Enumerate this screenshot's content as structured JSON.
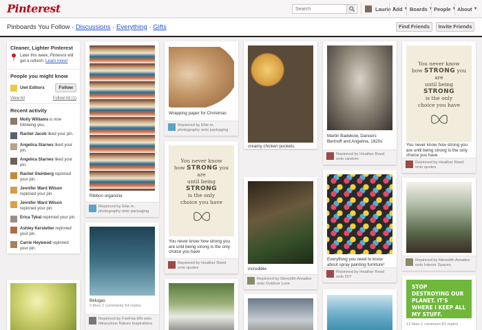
{
  "header": {
    "logo": "Pinterest",
    "search_placeholder": "Search",
    "nav": {
      "user": "Laurie",
      "add": "Add",
      "boards": "Boards",
      "people": "People",
      "about": "About"
    }
  },
  "subheader": {
    "title": "Pinboards You Follow · ",
    "links": [
      "Discussions",
      "Everything",
      "Gifts"
    ],
    "sep": " · ",
    "find_friends": "Find Friends",
    "invite_friends": "Invite Friends"
  },
  "sidebar": {
    "notice_title": "Cleaner, Lighter Pinterest",
    "notice_text": "Later this week, Pinterest will get a refresh.",
    "notice_link": "Learn more!",
    "people_title": "People you might know",
    "suggested_user": "Uwl Editors",
    "follow_label": "Follow",
    "view_all": "View All",
    "follow_all": "Follow All (1)",
    "recent_title": "Recent activity",
    "activity": [
      {
        "name": "Molly Williams",
        "action": " is now following you."
      },
      {
        "name": "Rachel Jacob",
        "action": " liked your pin."
      },
      {
        "name": "Angelica Starnes",
        "action": " liked your pin."
      },
      {
        "name": "Angelica Starnes",
        "action": " liked your pin."
      },
      {
        "name": "Rachel Steinberg",
        "action": " repinned your pin."
      },
      {
        "name": "Jennifer Ward Wilson",
        "action": " repinned your pin."
      },
      {
        "name": "Jennifer Ward Wilson",
        "action": " repinned your pin."
      },
      {
        "name": "Erica Tykal",
        "action": " repinned your pin."
      },
      {
        "name": "Ashley Kerstetter",
        "action": " repinned your pin."
      },
      {
        "name": "Carrie Heywood",
        "action": " repinned your pin."
      }
    ]
  },
  "pins": {
    "ribbon": {
      "desc": "Ribbon organizer.",
      "foot": "Repinned by Ellie m. photography onto packaging"
    },
    "paper": {
      "desc": "Wrapping paper for Christmas",
      "foot": "Repinned by Ellie m. photography onto packaging"
    },
    "pastry": {
      "desc": "creamy chicken pockets.",
      "foot": "Repinned by Heather Reed onto Maybe I can cook or make this?"
    },
    "dancers": {
      "desc": "Martin Badekow, Dancers Berinoff and Angelina, 1920s",
      "foot": "Repinned by Heather Reed onto random"
    },
    "quote1": {
      "line1": "You never know",
      "line2": "how",
      "strong": "STRONG",
      "line3": "you are",
      "line4": "until being",
      "line5": "is the only",
      "line6": "choice you have",
      "desc": "You never know how strong you are until being strong is the only choice you have",
      "foot": "Repinned by Heather Reed onto quotes"
    },
    "quote2": {
      "line1": "You never know",
      "line2": "how",
      "strong": "STRONG",
      "line3": "you are",
      "line4": "until being",
      "line5": "is the only",
      "line6": "choice you have",
      "desc": "You never know how strong you are until being strong is the only choice you have",
      "foot": "Repinned by Heather Reed onto quotes"
    },
    "beluga": {
      "desc": "Belugas",
      "stats": "2 likes  2 comments  54 repins",
      "foot": "Repinned by FeeFee.RN onto Miraculous Nature Inspirations"
    },
    "house": {
      "desc": "incredible",
      "foot": "Repinned by Meredith Amadee onto Outdoor Love"
    },
    "spray": {
      "desc": "Everything you need to know about spray painting furniture!",
      "foot": "Repinned by Heather Reed onto DIY"
    },
    "hut": {
      "foot": "Repinned by Meredith Amadee onto Interior Spaces"
    },
    "banner": {
      "text": "Stop destroying our planet. It's where I keep all my stuff.",
      "stats": "12 likes  1 comment  81 repins"
    }
  },
  "colors": {
    "brand": "#b7081b",
    "link": "#2255cc"
  }
}
